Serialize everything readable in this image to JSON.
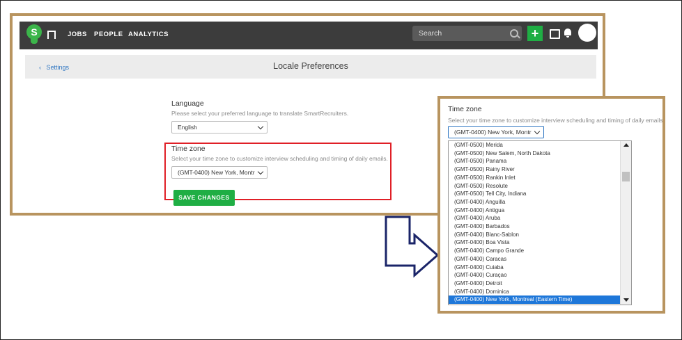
{
  "topbar": {
    "logo_letter": "S",
    "nav": [
      "JOBS",
      "PEOPLE",
      "ANALYTICS"
    ],
    "search_placeholder": "Search",
    "add_label": "+"
  },
  "page": {
    "back_label": "Settings",
    "back_arrow": "‹",
    "title": "Locale Preferences"
  },
  "form": {
    "language_label": "Language",
    "language_help": "Please select your preferred language to translate SmartRecruiters.",
    "language_value": "English",
    "timezone_label": "Time zone",
    "timezone_help": "Select your time zone to customize interview scheduling and timing of daily emails.",
    "timezone_value": "(GMT-0400) New York, Montr",
    "save_label": "SAVE CHANGES"
  },
  "zoom": {
    "timezone_label": "Time zone",
    "timezone_help": "Select your time zone to customize interview scheduling and timing of daily emails.",
    "timezone_value": "(GMT-0400) New York, Montr",
    "options": [
      "(GMT-0500) Merida",
      "(GMT-0500) New Salem, North Dakota",
      "(GMT-0500) Panama",
      "(GMT-0500) Rainy River",
      "(GMT-0500) Rankin Inlet",
      "(GMT-0500) Resolute",
      "(GMT-0500) Tell City, Indiana",
      "(GMT-0400) Anguilla",
      "(GMT-0400) Antigua",
      "(GMT-0400) Aruba",
      "(GMT-0400) Barbados",
      "(GMT-0400) Blanc-Sablon",
      "(GMT-0400) Boa Vista",
      "(GMT-0400) Campo Grande",
      "(GMT-0400) Caracas",
      "(GMT-0400) Cuiaba",
      "(GMT-0400) Curaçao",
      "(GMT-0400) Detroit",
      "(GMT-0400) Dominica",
      "(GMT-0400) New York, Montreal (Eastern Time)"
    ],
    "selected_option": "(GMT-0400) New York, Montreal (Eastern Time)"
  },
  "colors": {
    "frame": "#b8945f",
    "highlight": "#e01f26",
    "brand_green": "#1fae44",
    "arrow": "#1a2468",
    "selection": "#1e77d9"
  },
  "icons": [
    "logo-icon",
    "bookmark-icon",
    "search-icon",
    "add-icon",
    "inbox-icon",
    "bell-icon",
    "avatar",
    "chevron-down-icon",
    "arrow-icon"
  ]
}
